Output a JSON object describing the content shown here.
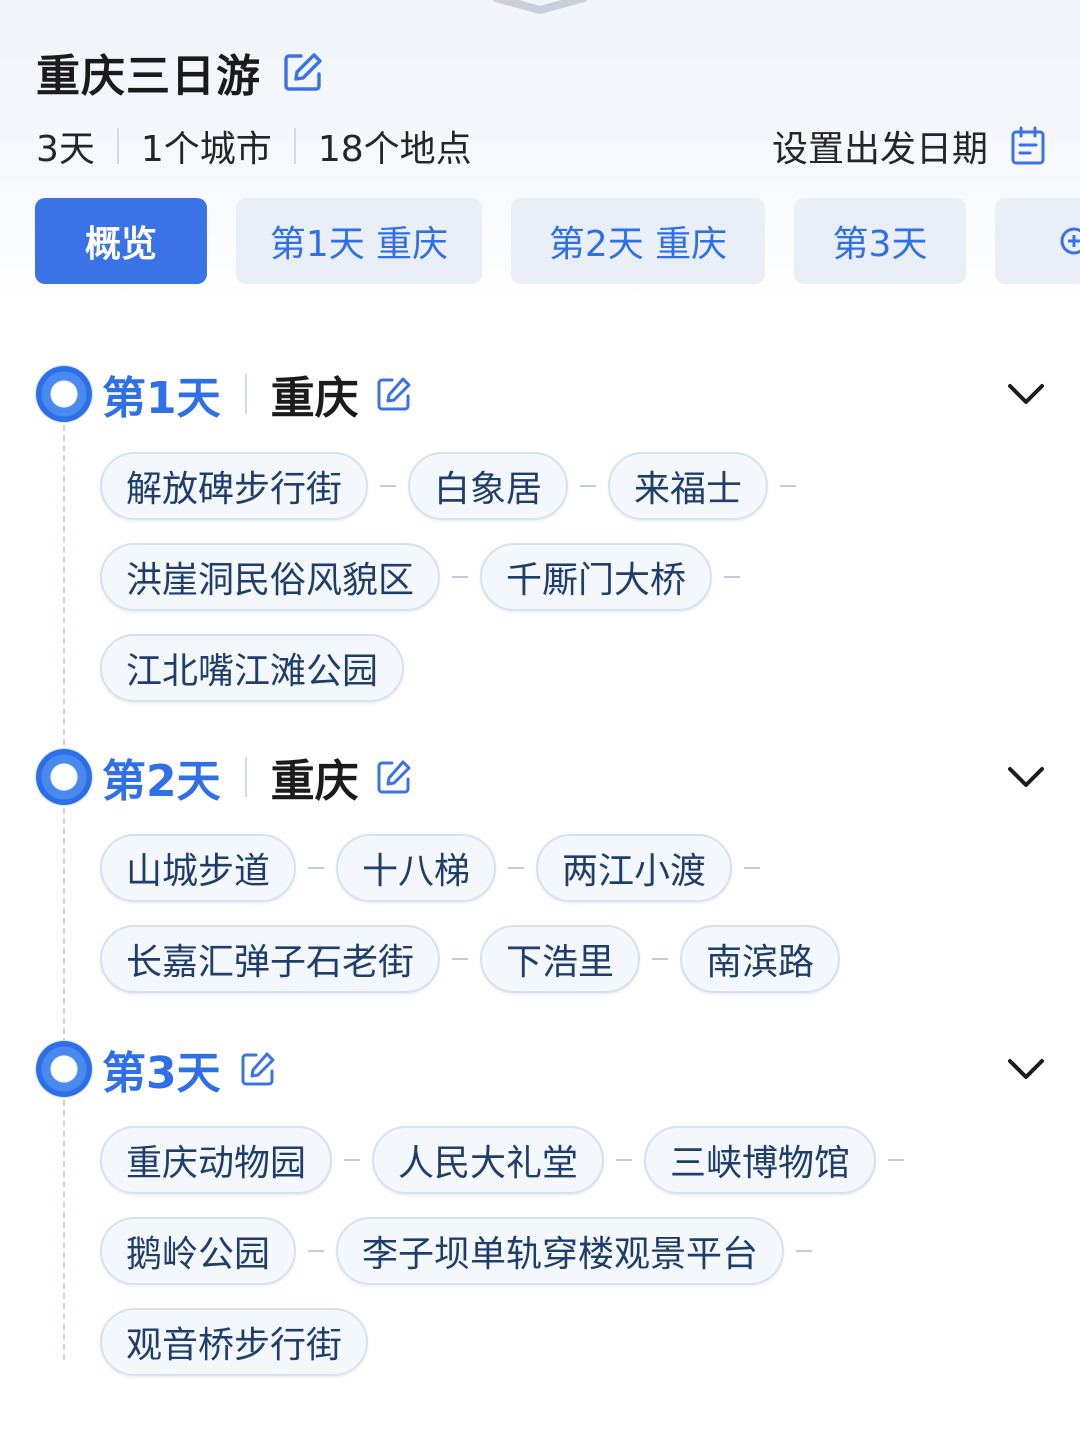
{
  "trip": {
    "title": "重庆三日游",
    "days": "3天",
    "cities": "1个城市",
    "places": "18个地点",
    "set_date": "设置出发日期"
  },
  "tabs": [
    {
      "label": "概览",
      "active": true
    },
    {
      "label": "第1天  重庆",
      "active": false
    },
    {
      "label": "第2天  重庆",
      "active": false
    },
    {
      "label": "第3天",
      "active": false
    }
  ],
  "day_list": [
    {
      "label": "第1天",
      "city": "重庆",
      "rows": [
        [
          "解放碑步行街",
          "白象居",
          "来福士"
        ],
        [
          "洪崖洞民俗风貌区",
          "千厮门大桥"
        ],
        [
          "江北嘴江滩公园"
        ]
      ]
    },
    {
      "label": "第2天",
      "city": "重庆",
      "rows": [
        [
          "山城步道",
          "十八梯",
          "两江小渡"
        ],
        [
          "长嘉汇弹子石老街",
          "下浩里",
          "南滨路"
        ]
      ]
    },
    {
      "label": "第3天",
      "city": "",
      "rows": [
        [
          "重庆动物园",
          "人民大礼堂",
          "三峡博物馆"
        ],
        [
          "鹅岭公园",
          "李子坝单轨穿楼观景平台"
        ],
        [
          "观音桥步行街"
        ]
      ]
    }
  ],
  "colors": {
    "accent": "#2f6fe8",
    "active_tab": "#3a73e6",
    "tab_bg": "#e9eef7",
    "chip_bg": "#f4f7fc",
    "chip_border": "#d7e1ef"
  },
  "icons": [
    "edit-icon",
    "calendar-icon",
    "chevron-down-icon",
    "plus-circle-icon",
    "timeline-dot-icon"
  ]
}
